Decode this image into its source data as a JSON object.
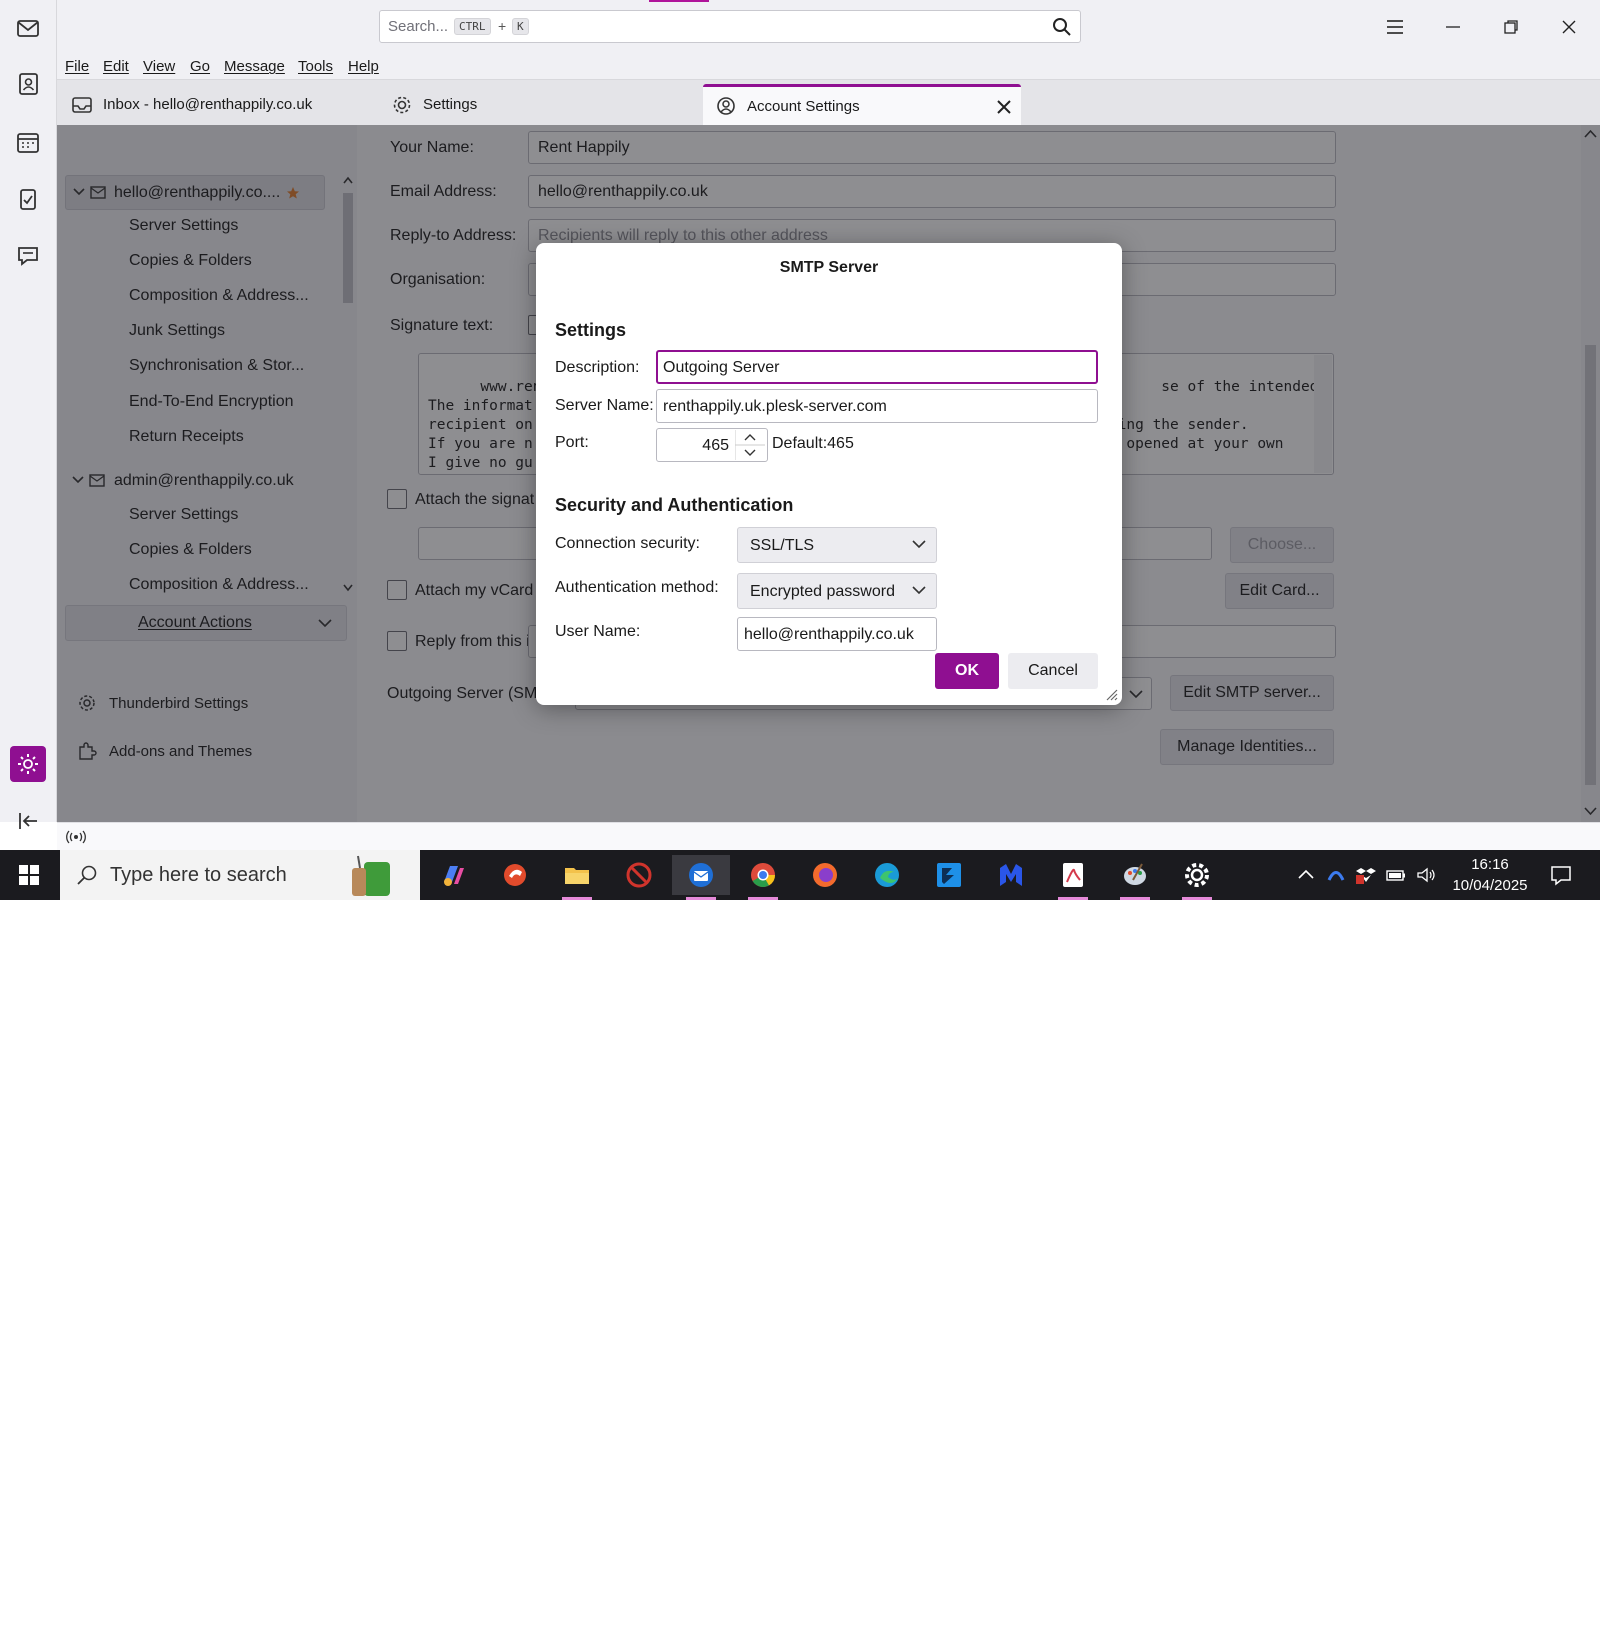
{
  "search": {
    "placeholder": "Search...",
    "key1": "CTRL",
    "plus": "+",
    "key2": "K"
  },
  "menu": [
    "File",
    "Edit",
    "View",
    "Go",
    "Message",
    "Tools",
    "Help"
  ],
  "tabs": [
    {
      "label": "Inbox - hello@renthappily.co.uk",
      "icon": "inbox-icon"
    },
    {
      "label": "Settings",
      "icon": "gear-icon"
    },
    {
      "label": "Account Settings",
      "icon": "account-settings-icon"
    }
  ],
  "sidebar": {
    "account1": "hello@renthappily.co....",
    "account1_items": [
      "Server Settings",
      "Copies & Folders",
      "Composition & Address...",
      "Junk Settings",
      "Synchronisation & Stor...",
      "End-To-End Encryption",
      "Return Receipts"
    ],
    "account2": "admin@renthappily.co.uk",
    "account2_items": [
      "Server Settings",
      "Copies & Folders",
      "Composition & Address..."
    ],
    "account_actions": "Account Actions",
    "thunderbird_settings": "Thunderbird Settings",
    "addons": "Add-ons and Themes"
  },
  "identity": {
    "your_name_label": "Your Name:",
    "your_name": "Rent Happily",
    "email_label": "Email Address:",
    "email": "hello@renthappily.co.uk",
    "reply_to_label": "Reply-to Address:",
    "reply_to_placeholder": "Recipients will reply to this other address",
    "organisation_label": "Organisation:",
    "signature_label": "Signature text:",
    "signature_text": "www.renthapp                                                                  se of the intended\nThe informat\nrecipient on                                                                  ying the sender.\nIf you are n                                                                  e opened at your own\nI give no gu\nrisk.",
    "attach_signature": "Attach the signat",
    "choose_button": "Choose...",
    "attach_vcard": "Attach my vCard",
    "edit_card_button": "Edit Card...",
    "reply_from": "Reply from this i",
    "outgoing_label": "Outgoing Server (SM",
    "edit_smtp_button": "Edit SMTP server...",
    "manage_identities_button": "Manage Identities..."
  },
  "dialog": {
    "title": "SMTP Server",
    "settings_heading": "Settings",
    "description_label": "Description:",
    "description_value": "Outgoing Server",
    "server_name_label": "Server Name:",
    "server_name_value": "renthappily.uk.plesk-server.com",
    "port_label": "Port:",
    "port_value": "465",
    "default_port": "Default:465",
    "security_heading": "Security and Authentication",
    "connection_security_label": "Connection security:",
    "connection_security_value": "SSL/TLS",
    "auth_method_label": "Authentication method:",
    "auth_method_value": "Encrypted password",
    "user_name_label": "User Name:",
    "user_name_value": "hello@renthappily.co.uk",
    "ok_label": "OK",
    "cancel_label": "Cancel"
  },
  "taskbar": {
    "search_placeholder": "Type here to search",
    "time": "16:16",
    "date": "10/04/2025"
  },
  "colors": {
    "accent": "#8f0f91",
    "overlay": "rgba(30,30,35,0.5)"
  }
}
